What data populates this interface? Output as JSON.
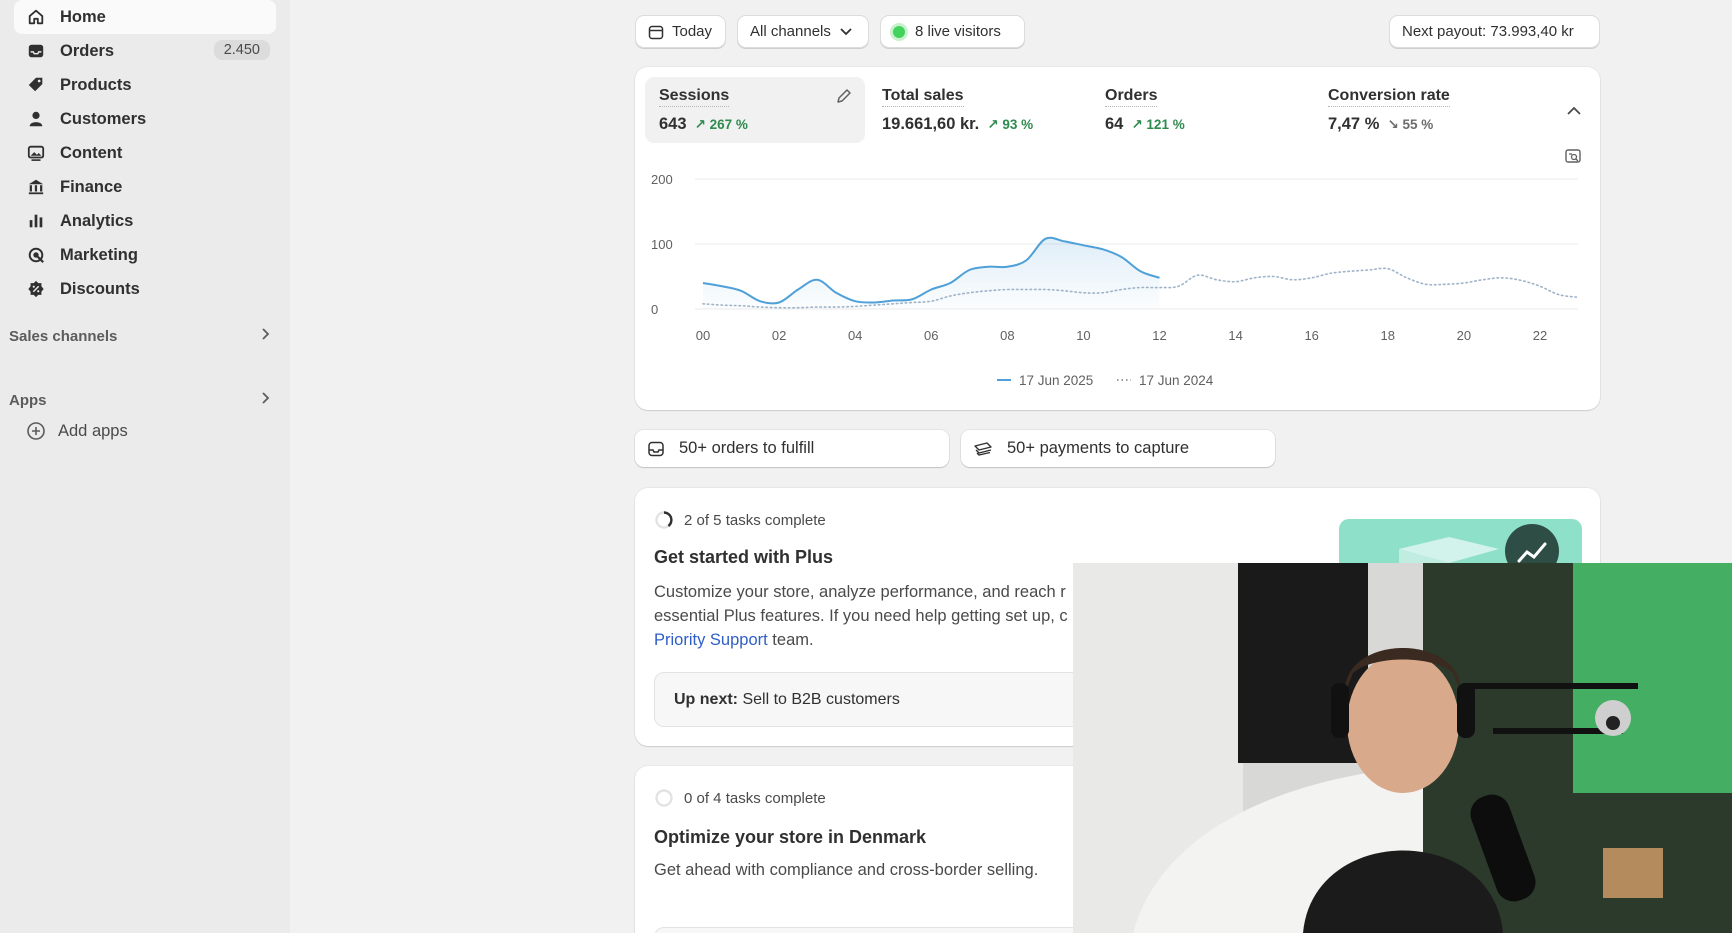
{
  "sidebar": {
    "items": [
      {
        "label": "Home",
        "icon": "home-icon",
        "active": true
      },
      {
        "label": "Orders",
        "icon": "inbox-icon",
        "badge": "2.450"
      },
      {
        "label": "Products",
        "icon": "tag-icon"
      },
      {
        "label": "Customers",
        "icon": "person-icon"
      },
      {
        "label": "Content",
        "icon": "image-icon"
      },
      {
        "label": "Finance",
        "icon": "bank-icon"
      },
      {
        "label": "Analytics",
        "icon": "bar-chart-icon"
      },
      {
        "label": "Marketing",
        "icon": "target-icon"
      },
      {
        "label": "Discounts",
        "icon": "discount-icon"
      }
    ],
    "sales_channels": "Sales channels",
    "apps": "Apps",
    "add_apps": "Add apps"
  },
  "topbar": {
    "date_filter": "Today",
    "channel_filter": "All channels",
    "live_visitors": "8 live visitors",
    "next_payout": "Next payout: 73.993,40 kr"
  },
  "metrics": [
    {
      "label": "Sessions",
      "value": "643",
      "change": "267 %",
      "direction": "up"
    },
    {
      "label": "Total sales",
      "value": "19.661,60 kr.",
      "change": "93 %",
      "direction": "up"
    },
    {
      "label": "Orders",
      "value": "64",
      "change": "121 %",
      "direction": "up"
    },
    {
      "label": "Conversion rate",
      "value": "7,47 %",
      "change": "55 %",
      "direction": "down"
    }
  ],
  "chart_data": {
    "type": "line",
    "x": [
      0,
      0.5,
      1,
      1.5,
      2,
      2.5,
      3,
      3.5,
      4,
      4.5,
      5,
      5.5,
      6,
      6.5,
      7,
      7.5,
      8,
      8.5,
      9,
      9.5,
      10,
      10.5,
      11,
      11.5,
      12,
      12.5,
      13,
      13.5,
      14,
      14.5,
      15,
      15.5,
      16,
      16.5,
      17,
      17.5,
      18,
      18.5,
      19,
      19.5,
      20,
      20.5,
      21,
      21.5,
      22,
      22.5,
      23
    ],
    "tick_labels": [
      "00",
      "02",
      "04",
      "06",
      "08",
      "10",
      "12",
      "14",
      "16",
      "18",
      "20",
      "22"
    ],
    "ylim": [
      0,
      200
    ],
    "yticks": [
      0,
      100,
      200
    ],
    "grid": true,
    "series": [
      {
        "name": "17 Jun 2025",
        "style": "solid",
        "color": "#4fa0d8",
        "values": [
          40,
          35,
          28,
          12,
          10,
          30,
          45,
          25,
          12,
          10,
          13,
          15,
          30,
          40,
          60,
          65,
          65,
          75,
          108,
          104,
          98,
          92,
          80,
          58,
          48
        ]
      },
      {
        "name": "17 Jun 2024",
        "style": "dotted",
        "color": "#9fb3c8",
        "values": [
          8,
          6,
          5,
          3,
          2,
          2,
          3,
          3,
          4,
          6,
          8,
          10,
          12,
          20,
          25,
          28,
          30,
          30,
          30,
          28,
          25,
          25,
          30,
          33,
          33,
          35,
          52,
          45,
          42,
          48,
          50,
          45,
          48,
          55,
          58,
          60,
          62,
          48,
          38,
          38,
          40,
          45,
          48,
          44,
          35,
          22,
          18
        ]
      }
    ]
  },
  "quick_actions": [
    {
      "label": "50+ orders to fulfill",
      "icon": "inbox-icon"
    },
    {
      "label": "50+ payments to capture",
      "icon": "cash-icon"
    }
  ],
  "setup_card": {
    "tasks": "2 of 5 tasks complete",
    "title": "Get started with Plus",
    "text_line1": "Customize your store, analyze performance, and reach r",
    "text_line2": "essential Plus features. If you need help getting set up, c",
    "link": "Priority Support",
    "text_after_link": " team.",
    "upnext_label": "Up next:",
    "upnext_value": " Sell to B2B customers"
  },
  "optimize_card": {
    "tasks": "0 of 4 tasks complete",
    "title": "Optimize your store in Denmark",
    "text": "Get ahead with compliance and cross-border selling."
  }
}
